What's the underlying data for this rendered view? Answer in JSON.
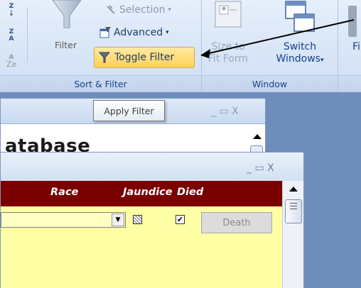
{
  "ribbon": {
    "selection_label": "Selection",
    "advanced_label": "Advanced",
    "toggle_filter_label": "Toggle Filter",
    "filter_label": "Filter",
    "group_sort_filter": "Sort & Filter",
    "size_to_fit_line1": "Size to",
    "size_to_fit_line2": "Fit Form",
    "switch_windows_line1": "Switch",
    "switch_windows_line2": "Windows",
    "group_window": "Window",
    "cut_label": "Fi"
  },
  "tooltip": {
    "text": "Apply Filter"
  },
  "background_window": {
    "heading": "atabase",
    "controls": "_ ▭ X"
  },
  "form_window": {
    "controls": "_ ▭ X",
    "headers": {
      "race": "Race",
      "jaundice": "Jaundice",
      "died": "Died"
    },
    "death_button": "Death"
  },
  "colors": {
    "header": "#7a0000",
    "detail": "#ffffa5",
    "highlight": "#ffd15a"
  },
  "icons": [
    "sort-ascending-icon",
    "sort-descending-icon",
    "clear-sort-icon",
    "filter-funnel-icon",
    "selection-icon",
    "advanced-filter-icon",
    "toggle-filter-icon",
    "size-to-fit-icon",
    "switch-windows-icon"
  ]
}
